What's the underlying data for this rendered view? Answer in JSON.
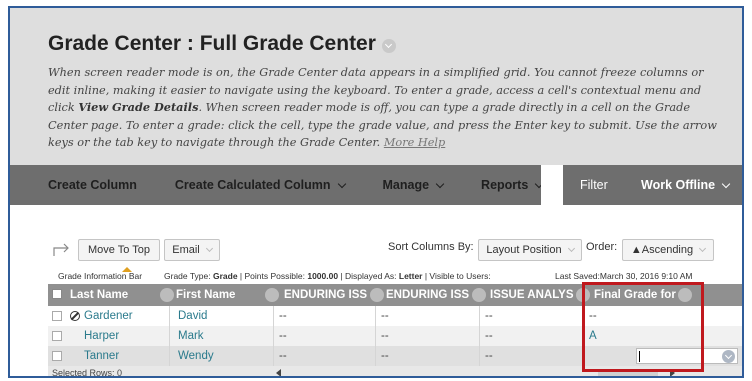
{
  "page": {
    "title": "Grade Center : Full Grade Center",
    "help_intro": "When screen reader mode is on, the Grade Center data appears in a simplified grid. You cannot freeze columns or edit inline, making it easier to navigate using the keyboard. To enter a grade, access a cell's contextual menu and click ",
    "help_bold": "View Grade Details",
    "help_rest": ". When screen reader mode is off, you can type a grade directly in a cell on the Grade Center page. To enter a grade: click the cell, type the grade value, and press the Enter key to submit. Use the arrow keys or the tab key to navigate through the Grade Center. ",
    "more_help": "More Help"
  },
  "actionbar": {
    "create_column": "Create Column",
    "create_calculated_column": "Create Calculated Column",
    "manage": "Manage",
    "reports": "Reports",
    "filter": "Filter",
    "work_offline": "Work Offline"
  },
  "toolbar": {
    "move_to_top": "Move To Top",
    "email": "Email",
    "sort_columns_by": "Sort Columns By:",
    "sort_value": "Layout Position",
    "order_label": "Order:",
    "order_value": "▲Ascending"
  },
  "infobar": {
    "left": "Grade Information Bar",
    "grade_type_label": "Grade Type: ",
    "grade_type": "Grade",
    "points_label": " | Points Possible: ",
    "points": "1000.00",
    "displayed_label": " | Displayed As: ",
    "displayed": "Letter",
    "visible": " | Visible to Users:",
    "last_saved": "Last Saved:March 30, 2016 9:10 AM"
  },
  "grid": {
    "columns": [
      "Last Name",
      "First Name",
      "ENDURING ISS",
      "ENDURING ISS",
      "ISSUE ANALYS",
      "Final Grade for"
    ],
    "rows": [
      {
        "last": "Gardener",
        "first": "David",
        "c1": "--",
        "c2": "--",
        "c3": "--",
        "final": "--"
      },
      {
        "last": "Harper",
        "first": "Mark",
        "c1": "--",
        "c2": "--",
        "c3": "--",
        "final": "A"
      },
      {
        "last": "Tanner",
        "first": "Wendy",
        "c1": "--",
        "c2": "--",
        "c3": "--",
        "final": ""
      }
    ]
  },
  "footer": {
    "selected_rows": "Selected Rows: 0"
  },
  "colors": {
    "frame": "#2f5c99",
    "highlight": "#c0191e",
    "link": "#2a7a8c",
    "actionbar": "#6e6e6e",
    "grid_header": "#909090"
  }
}
